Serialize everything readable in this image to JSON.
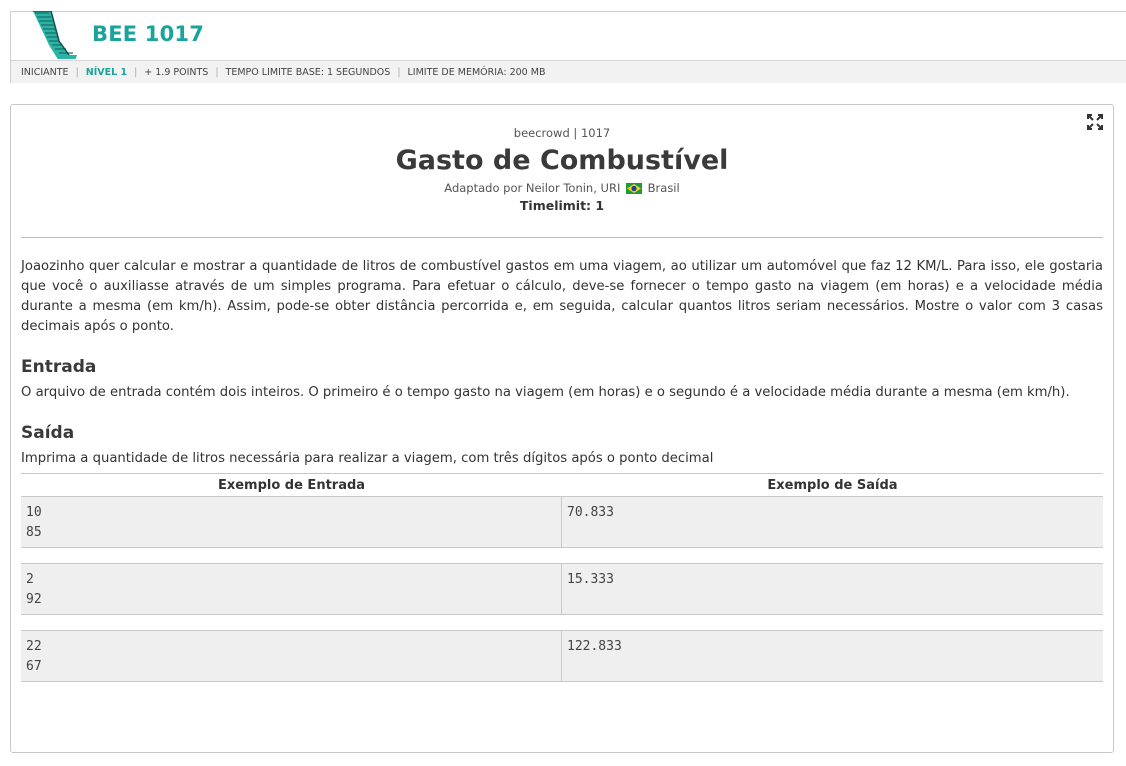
{
  "header": {
    "code": "BEE 1017",
    "meta": {
      "category": "INICIANTE",
      "level": "NÍVEL 1",
      "points": "+ 1.9 POINTS",
      "time_limit": "TEMPO LIMITE BASE: 1 SEGUNDOS",
      "memory_limit": "LIMITE DE MEMÓRIA: 200 MB"
    }
  },
  "problem": {
    "source": "beecrowd | 1017",
    "title": "Gasto de Combustível",
    "author_prefix": "Adaptado por Neilor Tonin, URI",
    "author_country": "Brasil",
    "timelimit": "Timelimit: 1",
    "description": "Joaozinho quer calcular e mostrar a quantidade de litros de combustível gastos em uma viagem, ao utilizar um automóvel que faz 12 KM/L. Para isso, ele gostaria que você o auxiliasse através de um simples programa. Para efetuar o cálculo, deve-se fornecer o tempo gasto na viagem (em horas) e a velocidade média durante a mesma (em km/h). Assim, pode-se obter distância percorrida e, em seguida, calcular quantos litros seriam necessários. Mostre o valor com 3 casas decimais após o ponto.",
    "input_title": "Entrada",
    "input_text": "O arquivo de entrada contém dois inteiros. O primeiro é o tempo gasto na viagem (em horas) e o segundo é a velocidade média durante a mesma (em km/h).",
    "output_title": "Saída",
    "output_text": "Imprima a quantidade de litros necessária para realizar a viagem, com três dígitos após o ponto decimal",
    "samples_header": {
      "input": "Exemplo de Entrada",
      "output": "Exemplo de Saída"
    },
    "samples": [
      {
        "input": "10\n85",
        "output": "70.833"
      },
      {
        "input": "2\n92",
        "output": "15.333"
      },
      {
        "input": "22\n67",
        "output": "122.833"
      }
    ]
  },
  "colors": {
    "accent": "#1aa39a",
    "sample_bg": "#efefef"
  },
  "icons": {
    "expand": "expand-icon",
    "flag": "brazil-flag-icon"
  }
}
